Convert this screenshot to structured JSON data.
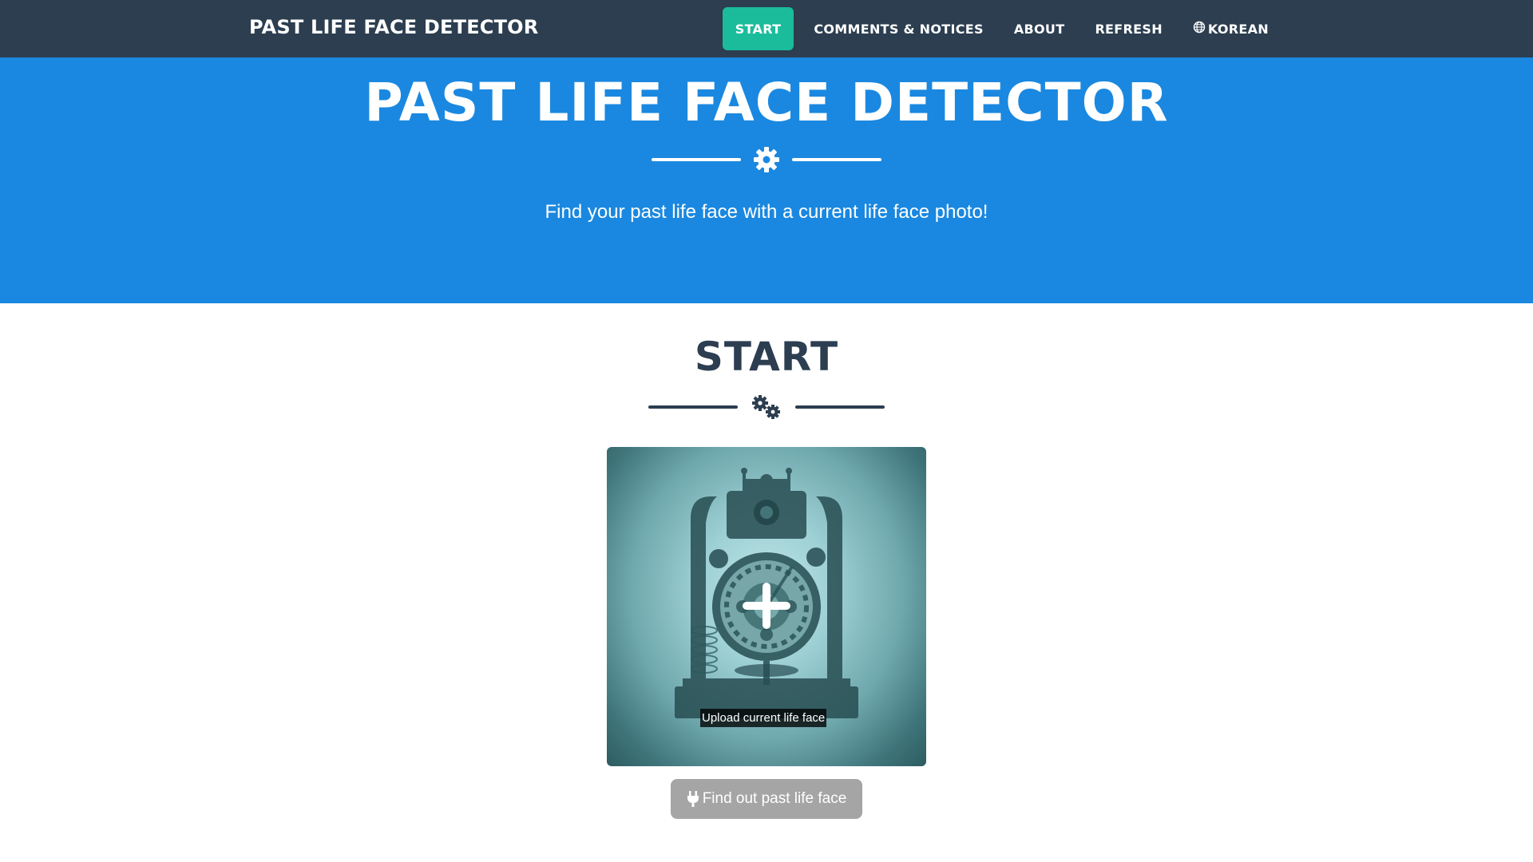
{
  "nav": {
    "brand": "PAST LIFE FACE DETECTOR",
    "items": [
      {
        "label": "START",
        "active": true
      },
      {
        "label": "COMMENTS & NOTICES",
        "active": false
      },
      {
        "label": "ABOUT",
        "active": false
      },
      {
        "label": "REFRESH",
        "active": false
      },
      {
        "label": "KOREAN",
        "icon": "globe-icon",
        "active": false
      }
    ]
  },
  "masthead": {
    "title": "PAST LIFE FACE DETECTOR",
    "divider_icon": "gear-icon",
    "subtitle": "Find your past life face with a current life face photo!"
  },
  "start_section": {
    "title": "START",
    "divider_icon": "gears-icon",
    "upload_label": "Upload current life face",
    "upload_icon": "plus-icon",
    "find_button": "Find out past life face",
    "find_button_icon": "plug-icon"
  },
  "colors": {
    "navbar": "#2c3e50",
    "active_nav": "#1abc9c",
    "masthead": "#1a88e0",
    "button_disabled": "#a5a5a5"
  }
}
